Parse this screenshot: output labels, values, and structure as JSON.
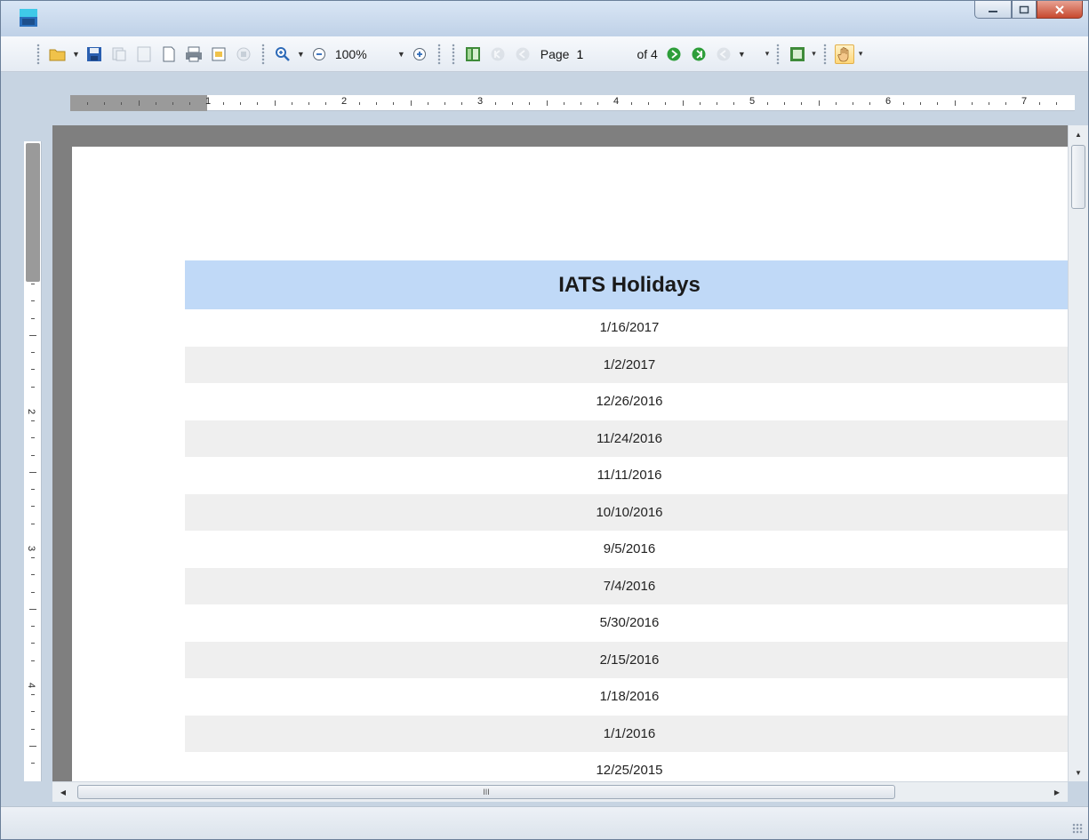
{
  "window": {
    "icon": "report-viewer-app-icon",
    "controls": [
      "minimize-icon",
      "maximize-icon",
      "close-icon"
    ]
  },
  "toolbar": {
    "zoom_value": "100%",
    "page_label": "Page",
    "page_value": "1",
    "page_of": "of 4",
    "icons": [
      "open-icon",
      "save-icon",
      "export-icon",
      "single-page-icon",
      "page-setup-icon",
      "print-icon",
      "print-preview-icon",
      "stop-icon",
      "zoom-icon",
      "zoom-out-icon",
      "zoom-in-icon",
      "document-map-icon",
      "first-page-icon",
      "previous-page-icon",
      "next-page-icon",
      "last-page-icon",
      "back-icon",
      "view-toggle-icon",
      "hand-tool-icon"
    ]
  },
  "rulers": {
    "horizontal_numbers": [
      "1",
      "2",
      "3",
      "4",
      "5",
      "6",
      "7"
    ],
    "vertical_numbers": [
      "2",
      "3",
      "4"
    ]
  },
  "report": {
    "title": "IATS Holidays",
    "rows": [
      "1/16/2017",
      "1/2/2017",
      "12/26/2016",
      "11/24/2016",
      "11/11/2016",
      "10/10/2016",
      "9/5/2016",
      "7/4/2016",
      "5/30/2016",
      "2/15/2016",
      "1/18/2016",
      "1/1/2016",
      "12/25/2015"
    ]
  },
  "scrollbar": {
    "hthumb_grip": "III"
  },
  "colors": {
    "title_background": "#c0d9f7",
    "alternate_row": "#efefef",
    "viewer_background": "#7f7f7f"
  }
}
